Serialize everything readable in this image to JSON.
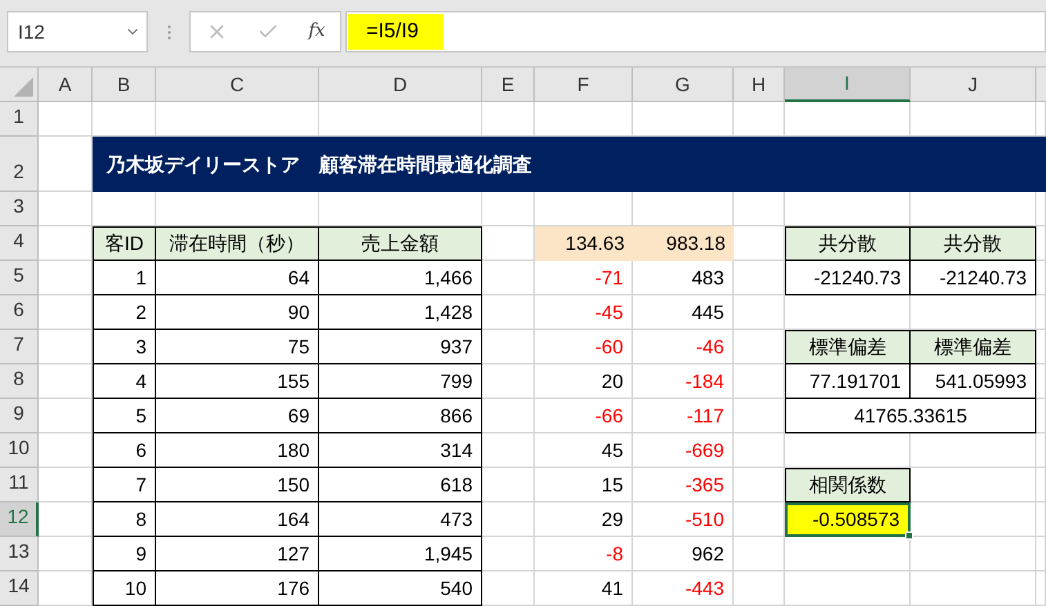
{
  "name_box": "I12",
  "function_button": "fx",
  "formula": "=I5/I9",
  "columns": [
    {
      "label": "A",
      "selected": false
    },
    {
      "label": "B",
      "selected": false
    },
    {
      "label": "C",
      "selected": false
    },
    {
      "label": "D",
      "selected": false
    },
    {
      "label": "E",
      "selected": false
    },
    {
      "label": "F",
      "selected": false
    },
    {
      "label": "G",
      "selected": false
    },
    {
      "label": "H",
      "selected": false
    },
    {
      "label": "I",
      "selected": true
    },
    {
      "label": "J",
      "selected": false
    }
  ],
  "rows": [
    {
      "label": "1",
      "selected": false
    },
    {
      "label": "2",
      "selected": false
    },
    {
      "label": "3",
      "selected": false
    },
    {
      "label": "4",
      "selected": false
    },
    {
      "label": "5",
      "selected": false
    },
    {
      "label": "6",
      "selected": false
    },
    {
      "label": "7",
      "selected": false
    },
    {
      "label": "8",
      "selected": false
    },
    {
      "label": "9",
      "selected": false
    },
    {
      "label": "10",
      "selected": false
    },
    {
      "label": "11",
      "selected": false
    },
    {
      "label": "12",
      "selected": true
    },
    {
      "label": "13",
      "selected": false
    },
    {
      "label": "14",
      "selected": false
    }
  ],
  "title": "乃木坂デイリーストア　顧客滞在時間最適化調査",
  "table": {
    "columns": [
      "客ID",
      "滞在時間（秒）",
      "売上金額"
    ],
    "rows": [
      [
        "1",
        "64",
        "1,466"
      ],
      [
        "2",
        "90",
        "1,428"
      ],
      [
        "3",
        "75",
        "937"
      ],
      [
        "4",
        "155",
        "799"
      ],
      [
        "5",
        "69",
        "866"
      ],
      [
        "6",
        "180",
        "314"
      ],
      [
        "7",
        "150",
        "618"
      ],
      [
        "8",
        "164",
        "473"
      ],
      [
        "9",
        "127",
        "1,945"
      ],
      [
        "10",
        "176",
        "540"
      ]
    ]
  },
  "deviations": {
    "means": [
      "134.63",
      "983.18"
    ],
    "rows": [
      [
        {
          "text": "-71",
          "negative": true
        },
        {
          "text": "483",
          "negative": false
        }
      ],
      [
        {
          "text": "-45",
          "negative": true
        },
        {
          "text": "445",
          "negative": false
        }
      ],
      [
        {
          "text": "-60",
          "negative": true
        },
        {
          "text": "-46",
          "negative": true
        }
      ],
      [
        {
          "text": "20",
          "negative": false
        },
        {
          "text": "-184",
          "negative": true
        }
      ],
      [
        {
          "text": "-66",
          "negative": true
        },
        {
          "text": "-117",
          "negative": true
        }
      ],
      [
        {
          "text": "45",
          "negative": false
        },
        {
          "text": "-669",
          "negative": true
        }
      ],
      [
        {
          "text": "15",
          "negative": false
        },
        {
          "text": "-365",
          "negative": true
        }
      ],
      [
        {
          "text": "29",
          "negative": false
        },
        {
          "text": "-510",
          "negative": true
        }
      ],
      [
        {
          "text": "-8",
          "negative": true
        },
        {
          "text": "962",
          "negative": false
        }
      ],
      [
        {
          "text": "41",
          "negative": false
        },
        {
          "text": "-443",
          "negative": true
        }
      ]
    ]
  },
  "covariance": {
    "headers": [
      "共分散",
      "共分散"
    ],
    "values": [
      "-21240.73",
      "-21240.73"
    ]
  },
  "std_dev": {
    "headers": [
      "標準偏差",
      "標準偏差"
    ],
    "values": [
      "77.191701",
      "541.05993"
    ],
    "product": "41765.33615"
  },
  "correlation": {
    "header": "相関係数",
    "value": "-0.508573",
    "selected": true
  }
}
